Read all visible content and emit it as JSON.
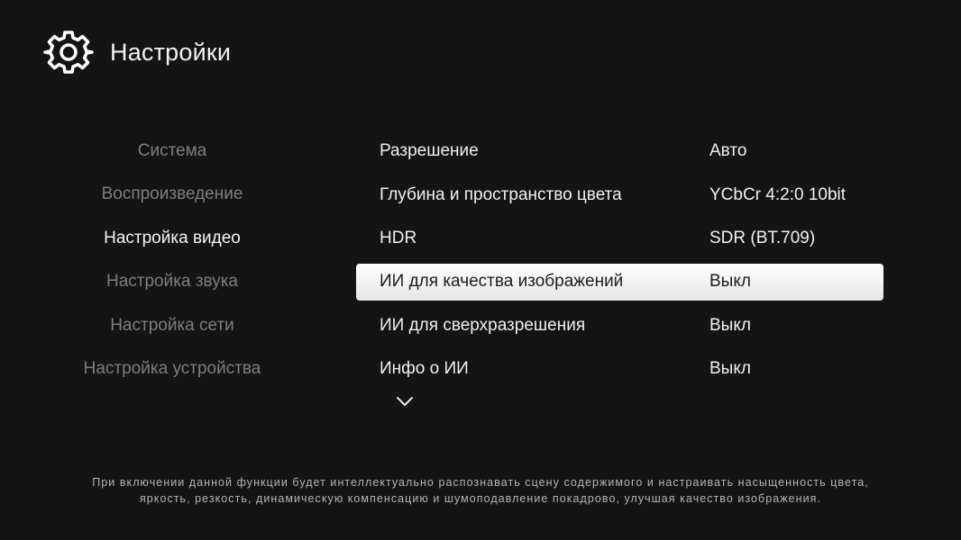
{
  "header": {
    "title": "Настройки",
    "icon": "gear-icon"
  },
  "sidebar": {
    "items": [
      {
        "label": "Система",
        "active": false
      },
      {
        "label": "Воспроизведение",
        "active": false
      },
      {
        "label": "Настройка видео",
        "active": true
      },
      {
        "label": "Настройка звука",
        "active": false
      },
      {
        "label": "Настройка сети",
        "active": false
      },
      {
        "label": "Настройка устройства",
        "active": false
      }
    ]
  },
  "settings": {
    "rows": [
      {
        "label": "Разрешение",
        "value": "Авто",
        "focused": false
      },
      {
        "label": "Глубина и пространство цвета",
        "value": "YCbCr 4:2:0 10bit",
        "focused": false
      },
      {
        "label": "HDR",
        "value": "SDR (BT.709)",
        "focused": false
      },
      {
        "label": "ИИ для качества изображений",
        "value": "Выкл",
        "focused": true
      },
      {
        "label": "ИИ для сверхразрешения",
        "value": "Выкл",
        "focused": false
      },
      {
        "label": "Инфо о ИИ",
        "value": "Выкл",
        "focused": false
      }
    ],
    "more_icon": "chevron-down-icon"
  },
  "description": {
    "line1": "При включении данной функции будет интеллектуально распознавать сцену содержимого и настраивать насыщенность цвета,",
    "line2": "яркость, резкость, динамическую компенсацию и шумоподавление покадрово, улучшая качество изображения."
  },
  "colors": {
    "background": "#141414",
    "text_active": "#f4f4f4",
    "text_inactive": "#7e7e7e",
    "focus_background": "#ffffff",
    "focus_text": "#1c1c1c"
  }
}
